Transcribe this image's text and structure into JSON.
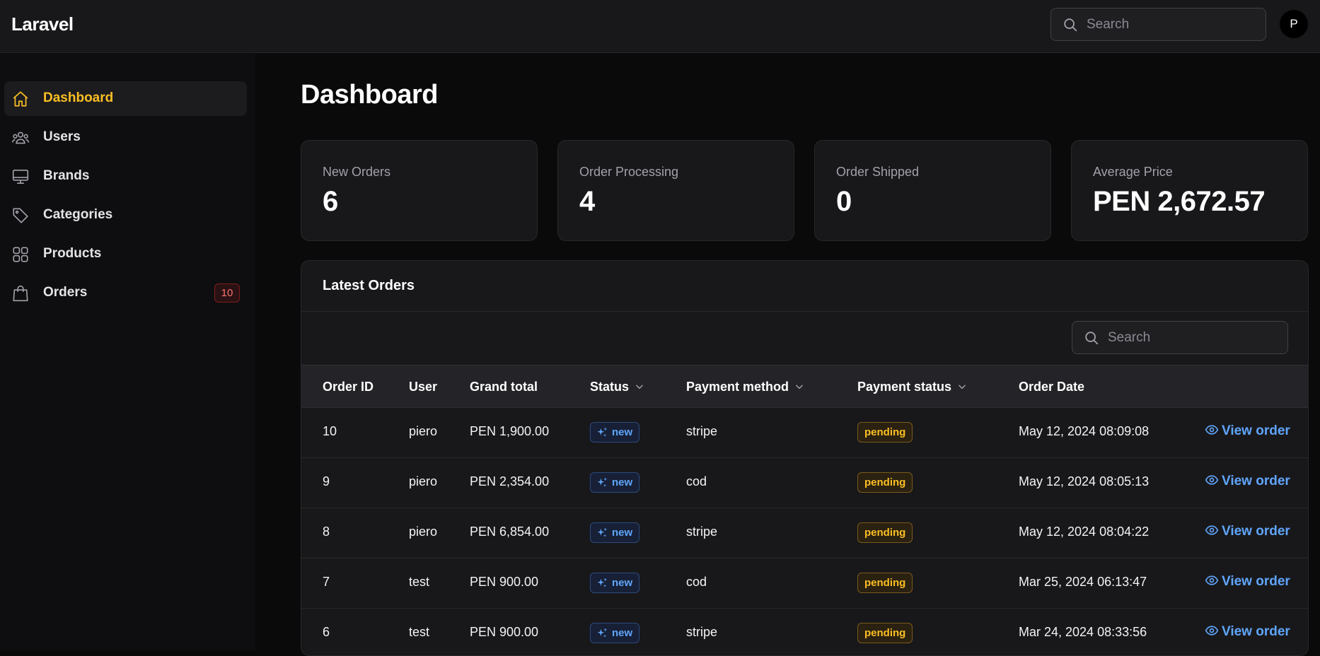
{
  "app": {
    "brand": "Laravel"
  },
  "header": {
    "search_placeholder": "Search",
    "avatar_initial": "P"
  },
  "sidebar": {
    "items": [
      {
        "label": "Dashboard",
        "icon": "home-icon",
        "active": true
      },
      {
        "label": "Users",
        "icon": "users-icon"
      },
      {
        "label": "Brands",
        "icon": "monitor-icon"
      },
      {
        "label": "Categories",
        "icon": "tag-icon"
      },
      {
        "label": "Products",
        "icon": "grid-icon"
      },
      {
        "label": "Orders",
        "icon": "shopping-bag-icon",
        "badge": "10"
      }
    ]
  },
  "main": {
    "title": "Dashboard",
    "stats": [
      {
        "label": "New Orders",
        "value": "6"
      },
      {
        "label": "Order Processing",
        "value": "4"
      },
      {
        "label": "Order Shipped",
        "value": "0"
      },
      {
        "label": "Average Price",
        "value": "PEN 2,672.57"
      }
    ],
    "orders": {
      "title": "Latest Orders",
      "search_placeholder": "Search",
      "columns": [
        "Order ID",
        "User",
        "Grand total",
        "Status",
        "Payment method",
        "Payment status",
        "Order Date"
      ],
      "rows": [
        {
          "id": "10",
          "user": "piero",
          "total": "PEN 1,900.00",
          "status": "new",
          "method": "stripe",
          "payment_status": "pending",
          "date": "May 12, 2024 08:09:08",
          "action": "View order"
        },
        {
          "id": "9",
          "user": "piero",
          "total": "PEN 2,354.00",
          "status": "new",
          "method": "cod",
          "payment_status": "pending",
          "date": "May 12, 2024 08:05:13",
          "action": "View order"
        },
        {
          "id": "8",
          "user": "piero",
          "total": "PEN 6,854.00",
          "status": "new",
          "method": "stripe",
          "payment_status": "pending",
          "date": "May 12, 2024 08:04:22",
          "action": "View order"
        },
        {
          "id": "7",
          "user": "test",
          "total": "PEN 900.00",
          "status": "new",
          "method": "cod",
          "payment_status": "pending",
          "date": "Mar 25, 2024 06:13:47",
          "action": "View order"
        },
        {
          "id": "6",
          "user": "test",
          "total": "PEN 900.00",
          "status": "new",
          "method": "stripe",
          "payment_status": "pending",
          "date": "Mar 24, 2024 08:33:56",
          "action": "View order"
        }
      ]
    }
  },
  "colors": {
    "accent": "#fbbf24",
    "link": "#60a5fa",
    "badge_danger": "#f87171"
  }
}
